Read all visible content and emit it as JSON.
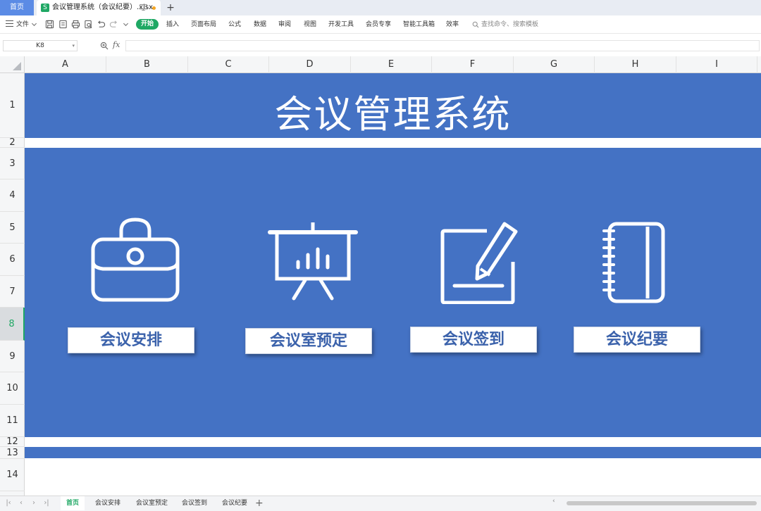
{
  "tabs": {
    "home": "首页",
    "file": "会议管理系统（会议纪要）.xlsx",
    "file_icon_letter": "S",
    "new_tab": "+"
  },
  "toolbar": {
    "file_menu": "文件",
    "start": "开始",
    "menus": [
      "插入",
      "页面布局",
      "公式",
      "数据",
      "审阅",
      "视图",
      "开发工具",
      "会员专享",
      "智能工具箱",
      "效率"
    ],
    "search_placeholder": "查找命令、搜索模板"
  },
  "formula_bar": {
    "cell_ref": "K8",
    "fx": "fx",
    "formula": ""
  },
  "columns": [
    "A",
    "B",
    "C",
    "D",
    "E",
    "F",
    "G",
    "H",
    "I"
  ],
  "rows": [
    "1",
    "2",
    "3",
    "4",
    "5",
    "6",
    "7",
    "8",
    "9",
    "10",
    "11",
    "12",
    "13",
    "14"
  ],
  "active_row": "8",
  "sheet": {
    "title": "会议管理系统",
    "band_color": "#4472c4",
    "buttons": [
      {
        "label": "会议安排",
        "icon": "briefcase-icon"
      },
      {
        "label": "会议室预定",
        "icon": "presentation-board-icon"
      },
      {
        "label": "会议签到",
        "icon": "edit-pencil-icon"
      },
      {
        "label": "会议纪要",
        "icon": "notebook-icon"
      }
    ]
  },
  "sheet_tabs": [
    "首页",
    "会议安排",
    "会议室预定",
    "会议签到",
    "会议纪要"
  ],
  "active_sheet": "首页",
  "colors": {
    "accent_green": "#1fa864",
    "button_text": "#3b62ab"
  }
}
